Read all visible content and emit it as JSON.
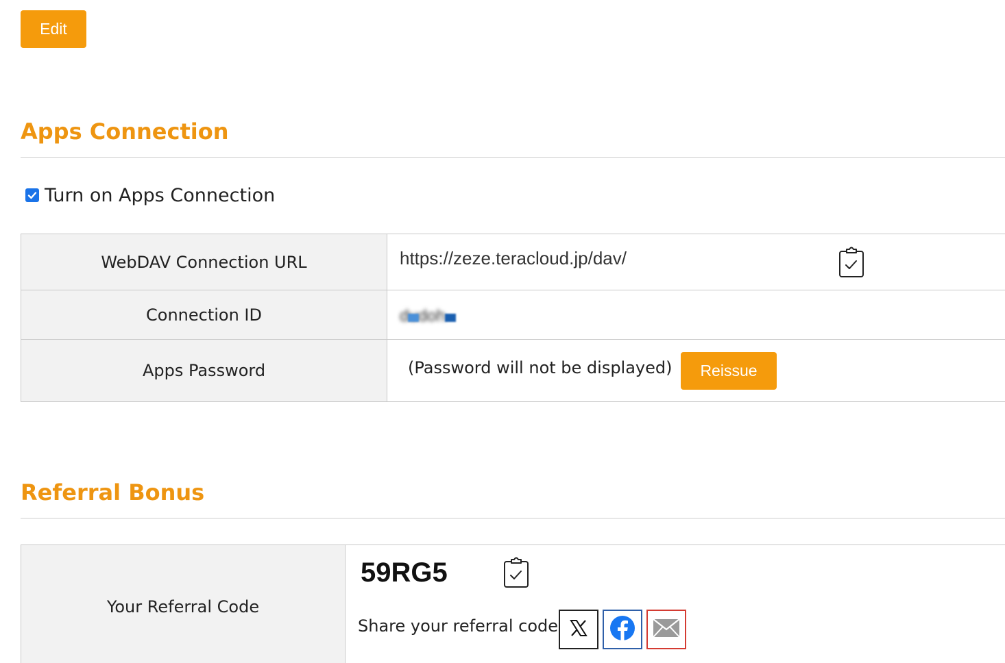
{
  "toolbar": {
    "edit_label": "Edit"
  },
  "apps_connection": {
    "title": "Apps Connection",
    "toggle_label": "Turn on Apps Connection",
    "toggle_checked": true,
    "rows": {
      "webdav": {
        "label": "WebDAV Connection URL",
        "value": "https://zeze.teracloud.jp/dav/",
        "copy_icon": "clipboard-check-icon"
      },
      "connection_id": {
        "label": "Connection ID",
        "value": "dudoh"
      },
      "password": {
        "label": "Apps Password",
        "note": "(Password will not be displayed)",
        "reissue_label": "Reissue"
      }
    }
  },
  "referral": {
    "title": "Referral Bonus",
    "row_label": "Your Referral Code",
    "code": "59RG5",
    "copy_icon": "clipboard-check-icon",
    "share_label": "Share your referral code:",
    "share_buttons": [
      {
        "name": "x-icon",
        "border": "#222222"
      },
      {
        "name": "facebook-icon",
        "border": "#2f5fa8"
      },
      {
        "name": "mail-icon",
        "border": "#d43b32"
      }
    ]
  },
  "colors": {
    "accent": "#f59b0c",
    "heading": "#ee9511",
    "checkbox": "#1a73e8",
    "facebook": "#1877f2"
  }
}
